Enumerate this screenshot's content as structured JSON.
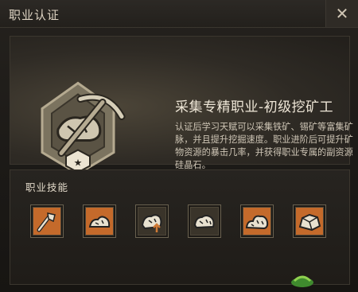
{
  "window": {
    "title": "职业认证",
    "close_icon": "close-icon"
  },
  "profession": {
    "name": "采集专精职业-初级挖矿工",
    "description": "认证后学习天赋可以采集铁矿、锡矿等富集矿脉，并且提升挖掘速度。职业进阶后可提升矿物资源的暴击几率，并获得职业专属的副资源硅晶石。",
    "emblem_icon": "miner-emblem-icon"
  },
  "skills": {
    "label": "职业技能",
    "items": [
      {
        "icon": "shovel-skill-icon"
      },
      {
        "icon": "ore-pile-skill-icon"
      },
      {
        "icon": "ore-upgrade-skill-icon"
      },
      {
        "icon": "ore-rock-skill-icon"
      },
      {
        "icon": "ore-cluster-skill-icon"
      },
      {
        "icon": "crystal-rock-skill-icon"
      }
    ]
  },
  "colors": {
    "accent": "#c96a2a",
    "text": "#d9cfbf",
    "panel": "#2f2b25"
  }
}
